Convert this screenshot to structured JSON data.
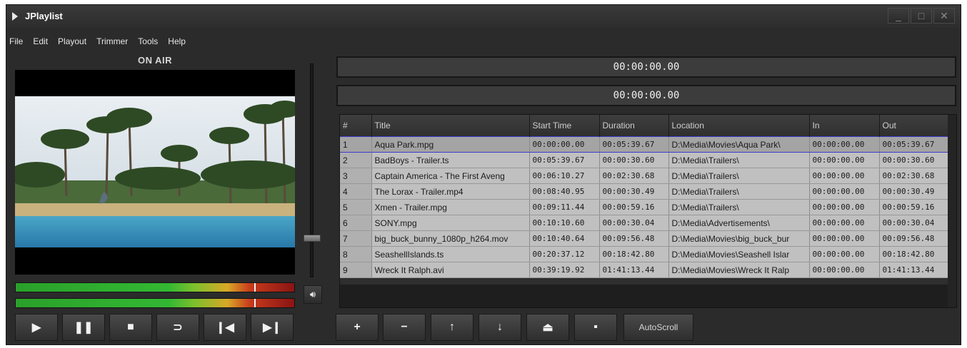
{
  "window": {
    "title": "JPlaylist",
    "controls": [
      "_",
      "□",
      "✕"
    ]
  },
  "menu": [
    "File",
    "Edit",
    "Playout",
    "Trimmer",
    "Tools",
    "Help"
  ],
  "on_air_label": "ON AIR",
  "timecodes": {
    "primary": "00:00:00.00",
    "secondary": "00:00:00.00"
  },
  "meters": {
    "level_fraction_1": 0.86,
    "level_fraction_2": 0.86
  },
  "volume_level_fraction": 0.25,
  "transport": {
    "play_icon": "▶",
    "pause_icon": "❚❚",
    "stop_icon": "■",
    "loop_icon": "⊃",
    "prev_icon": "❙◀",
    "next_icon": "▶❙"
  },
  "playlist_toolbar": {
    "add_icon": "+",
    "remove_icon": "−",
    "up_icon": "↑",
    "down_icon": "↓",
    "eject_icon": "⏏",
    "save_icon": "▪",
    "autoscroll_label": "AutoScroll"
  },
  "volume_icon": "🔊︎",
  "playlist": {
    "columns": [
      "#",
      "Title",
      "Start Time",
      "Duration",
      "Location",
      "In",
      "Out"
    ],
    "rows": [
      [
        "1",
        "Aqua Park.mpg",
        "00:00:00.00",
        "00:05:39.67",
        "D:\\Media\\Movies\\Aqua Park\\",
        "00:00:00.00",
        "00:05:39.67"
      ],
      [
        "2",
        "BadBoys - Trailer.ts",
        "00:05:39.67",
        "00:00:30.60",
        "D:\\Media\\Trailers\\",
        "00:00:00.00",
        "00:00:30.60"
      ],
      [
        "3",
        "Captain America - The First Aveng",
        "00:06:10.27",
        "00:02:30.68",
        "D:\\Media\\Trailers\\",
        "00:00:00.00",
        "00:02:30.68"
      ],
      [
        "4",
        "The Lorax - Trailer.mp4",
        "00:08:40.95",
        "00:00:30.49",
        "D:\\Media\\Trailers\\",
        "00:00:00.00",
        "00:00:30.49"
      ],
      [
        "5",
        "Xmen - Trailer.mpg",
        "00:09:11.44",
        "00:00:59.16",
        "D:\\Media\\Trailers\\",
        "00:00:00.00",
        "00:00:59.16"
      ],
      [
        "6",
        "SONY.mpg",
        "00:10:10.60",
        "00:00:30.04",
        "D:\\Media\\Advertisements\\",
        "00:00:00.00",
        "00:00:30.04"
      ],
      [
        "7",
        "big_buck_bunny_1080p_h264.mov",
        "00:10:40.64",
        "00:09:56.48",
        "D:\\Media\\Movies\\big_buck_bur",
        "00:00:00.00",
        "00:09:56.48"
      ],
      [
        "8",
        "SeashellIslands.ts",
        "00:20:37.12",
        "00:18:42.80",
        "D:\\Media\\Movies\\Seashell Islar",
        "00:00:00.00",
        "00:18:42.80"
      ],
      [
        "9",
        "Wreck It Ralph.avi",
        "00:39:19.92",
        "01:41:13.44",
        "D:\\Media\\Movies\\Wreck It Ralp",
        "00:00:00.00",
        "01:41:13.44"
      ]
    ],
    "selected_row": 0
  }
}
